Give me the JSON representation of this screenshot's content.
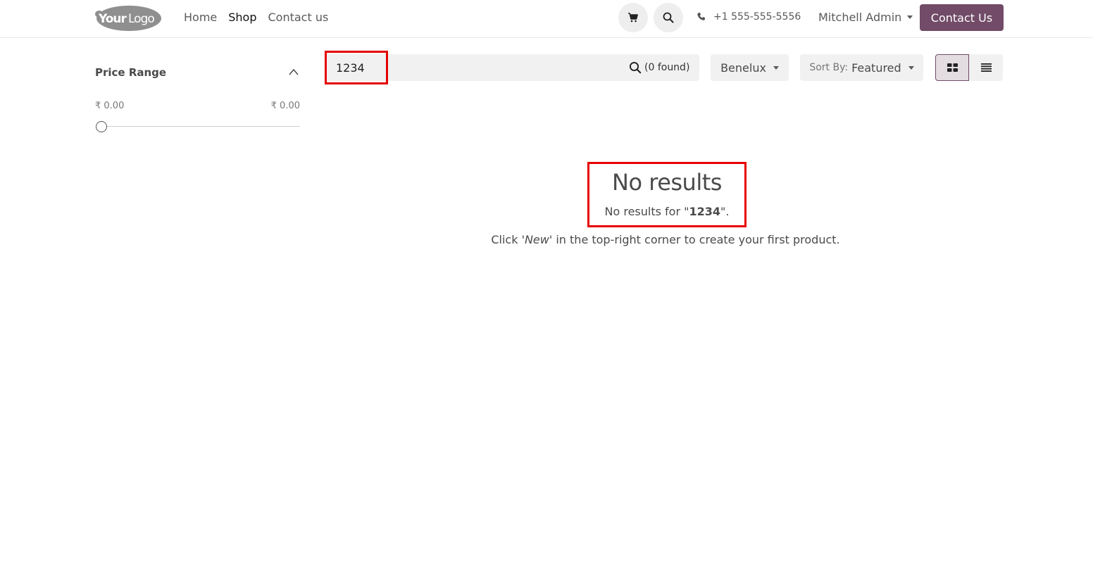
{
  "header": {
    "logo_text": "YourLogo",
    "nav": [
      {
        "label": "Home",
        "active": false
      },
      {
        "label": "Shop",
        "active": true
      },
      {
        "label": "Contact us",
        "active": false
      }
    ],
    "cart_icon": "cart-icon",
    "search_icon": "search-icon",
    "phone": "+1 555-555-5556",
    "user": "Mitchell Admin",
    "contact_button": "Contact Us"
  },
  "sidebar": {
    "price_range_title": "Price Range",
    "price_min": "₹ 0.00",
    "price_max": "₹ 0.00"
  },
  "toolbar": {
    "search_value": "1234",
    "found_text": "(0 found)",
    "pricelist": "Benelux",
    "sort_label": "Sort By:",
    "sort_value": "Featured",
    "view_modes": [
      "grid-view-icon",
      "list-view-icon"
    ]
  },
  "empty_state": {
    "title": "No results",
    "sub_prefix": "No results for \"",
    "query": "1234",
    "sub_suffix": "\".",
    "hint_prefix": "Click ",
    "hint_emphasis": "'New'",
    "hint_suffix": " in the top-right corner to create your first product."
  },
  "colors": {
    "brand": "#714b67",
    "highlight": "#e60000"
  }
}
